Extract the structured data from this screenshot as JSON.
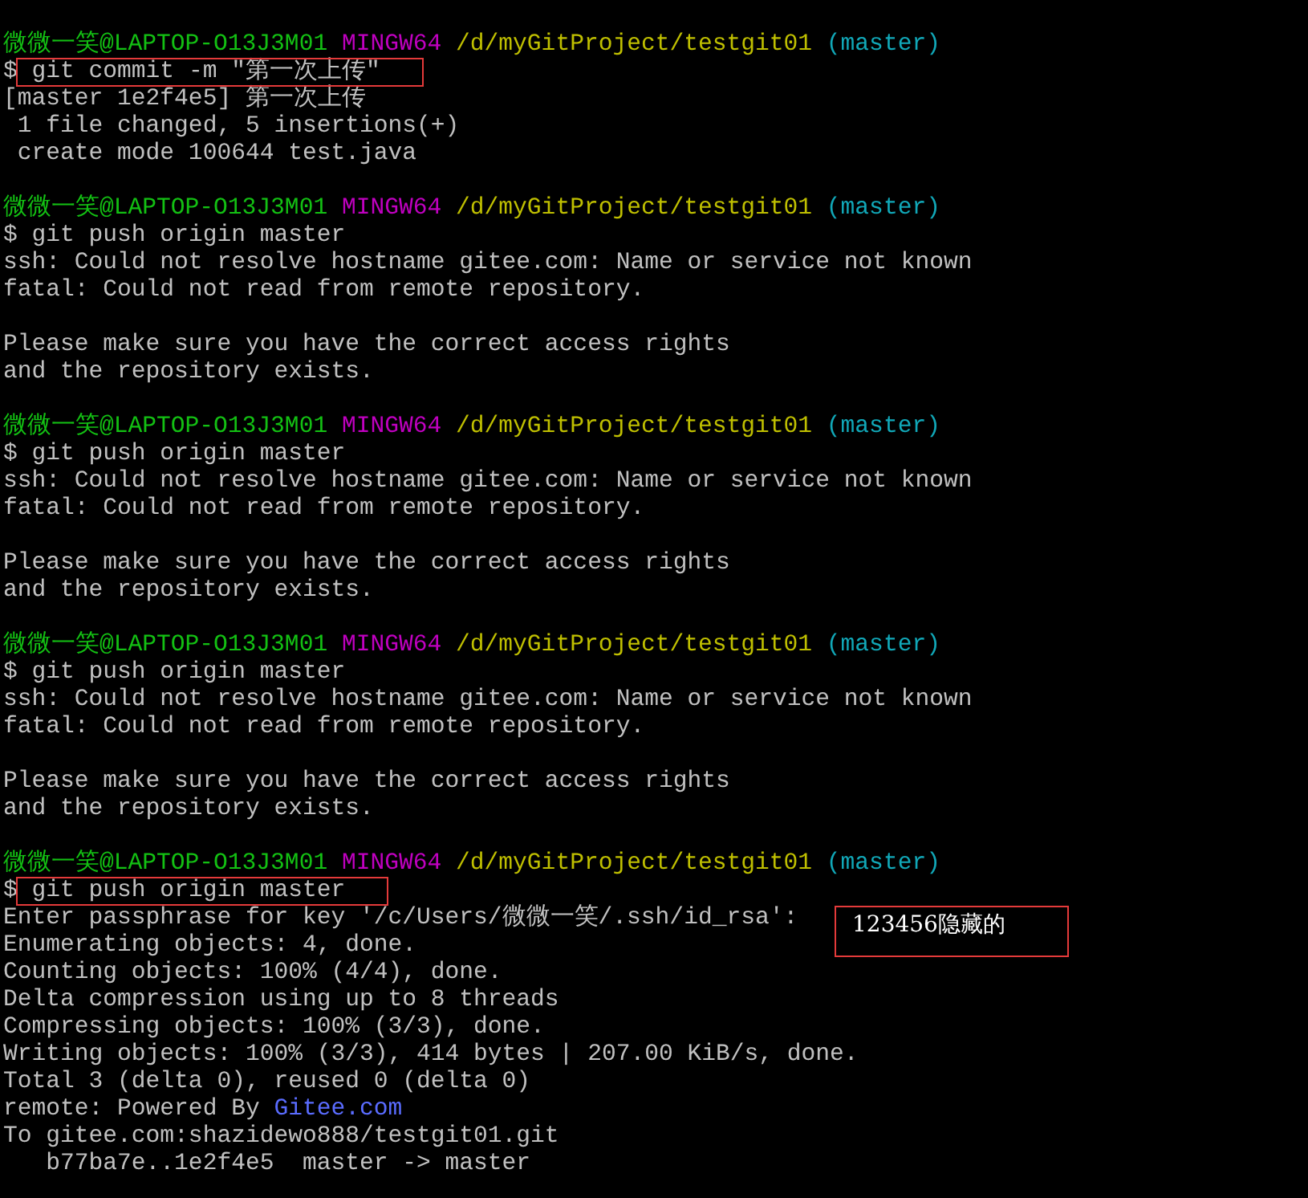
{
  "terminal": {
    "lines": [
      {
        "kind": "prompt",
        "user_host": "微微一笑@LAPTOP-O13J3M01",
        "system": "MINGW64",
        "path": "/d/myGitProject/testgit01",
        "branch": "(master)"
      },
      {
        "kind": "command",
        "prompt": "$",
        "text": "git commit -m \"第一次上传\"",
        "boxed": true
      },
      {
        "kind": "output",
        "text": "[master 1e2f4e5] 第一次上传"
      },
      {
        "kind": "output",
        "text": " 1 file changed, 5 insertions(+)"
      },
      {
        "kind": "output",
        "text": " create mode 100644 test.java"
      },
      {
        "kind": "blank"
      },
      {
        "kind": "prompt",
        "user_host": "微微一笑@LAPTOP-O13J3M01",
        "system": "MINGW64",
        "path": "/d/myGitProject/testgit01",
        "branch": "(master)"
      },
      {
        "kind": "command",
        "prompt": "$",
        "text": "git push origin master",
        "boxed": false
      },
      {
        "kind": "output",
        "text": "ssh: Could not resolve hostname gitee.com: Name or service not known"
      },
      {
        "kind": "output",
        "text": "fatal: Could not read from remote repository."
      },
      {
        "kind": "blank"
      },
      {
        "kind": "output",
        "text": "Please make sure you have the correct access rights"
      },
      {
        "kind": "output",
        "text": "and the repository exists."
      },
      {
        "kind": "blank"
      },
      {
        "kind": "prompt",
        "user_host": "微微一笑@LAPTOP-O13J3M01",
        "system": "MINGW64",
        "path": "/d/myGitProject/testgit01",
        "branch": "(master)"
      },
      {
        "kind": "command",
        "prompt": "$",
        "text": "git push origin master",
        "boxed": false
      },
      {
        "kind": "output",
        "text": "ssh: Could not resolve hostname gitee.com: Name or service not known"
      },
      {
        "kind": "output",
        "text": "fatal: Could not read from remote repository."
      },
      {
        "kind": "blank"
      },
      {
        "kind": "output",
        "text": "Please make sure you have the correct access rights"
      },
      {
        "kind": "output",
        "text": "and the repository exists."
      },
      {
        "kind": "blank"
      },
      {
        "kind": "prompt",
        "user_host": "微微一笑@LAPTOP-O13J3M01",
        "system": "MINGW64",
        "path": "/d/myGitProject/testgit01",
        "branch": "(master)"
      },
      {
        "kind": "command",
        "prompt": "$",
        "text": "git push origin master",
        "boxed": false
      },
      {
        "kind": "output",
        "text": "ssh: Could not resolve hostname gitee.com: Name or service not known"
      },
      {
        "kind": "output",
        "text": "fatal: Could not read from remote repository."
      },
      {
        "kind": "blank"
      },
      {
        "kind": "output",
        "text": "Please make sure you have the correct access rights"
      },
      {
        "kind": "output",
        "text": "and the repository exists."
      },
      {
        "kind": "blank"
      },
      {
        "kind": "prompt",
        "user_host": "微微一笑@LAPTOP-O13J3M01",
        "system": "MINGW64",
        "path": "/d/myGitProject/testgit01",
        "branch": "(master)"
      },
      {
        "kind": "command",
        "prompt": "$",
        "text": "git push origin master",
        "boxed": true
      },
      {
        "kind": "output",
        "text": "Enter passphrase for key '/c/Users/微微一笑/.ssh/id_rsa':",
        "note": "123456隐藏的"
      },
      {
        "kind": "output",
        "text": "Enumerating objects: 4, done."
      },
      {
        "kind": "output",
        "text": "Counting objects: 100% (4/4), done."
      },
      {
        "kind": "output",
        "text": "Delta compression using up to 8 threads"
      },
      {
        "kind": "output",
        "text": "Compressing objects: 100% (3/3), done."
      },
      {
        "kind": "output",
        "text": "Writing objects: 100% (3/3), 414 bytes | 207.00 KiB/s, done."
      },
      {
        "kind": "output",
        "text": "Total 3 (delta 0), reused 0 (delta 0)"
      },
      {
        "kind": "link_output",
        "text": "remote: Powered By",
        "link": "Gitee.com"
      },
      {
        "kind": "output",
        "text": "To gitee.com:shazidewo888/testgit01.git"
      },
      {
        "kind": "output",
        "text": "   b77ba7e..1e2f4e5  master -> master"
      }
    ]
  }
}
